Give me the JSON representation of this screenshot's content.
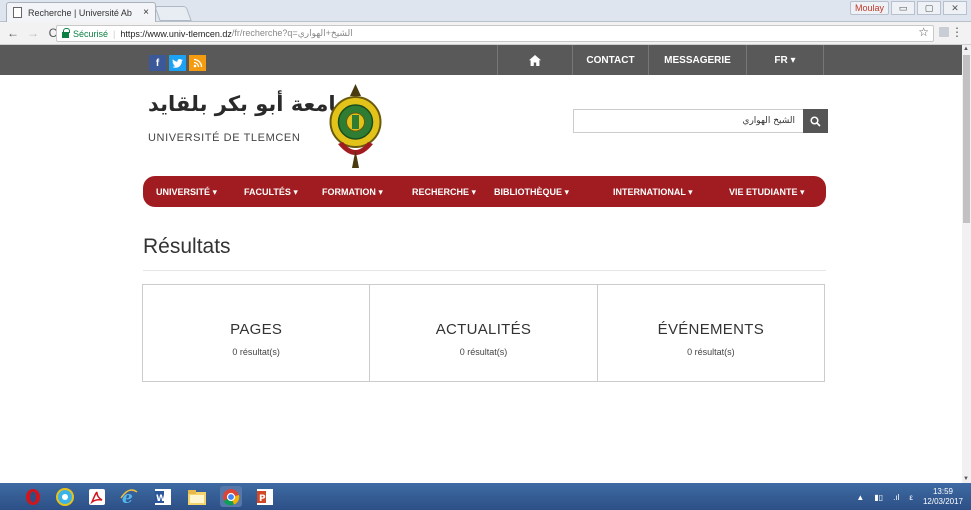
{
  "browser": {
    "tab_title": "Recherche | Université Ab",
    "tab_close": "×",
    "user_label": "Moulay",
    "win_minimize": "▭",
    "win_maximize": "▢",
    "win_close": "✕",
    "secure_label": "Sécurisé",
    "url_host": "https://www.univ-tlemcen.dz",
    "url_path": "/fr/recherche?q=الشيخ+الهواري",
    "back": "←",
    "forward": "→",
    "reload": "C",
    "bookmark_star": "☆",
    "menu": "⋮"
  },
  "topbar": {
    "social": [
      {
        "icon": "facebook-icon",
        "glyph": "f"
      },
      {
        "icon": "twitter-icon",
        "glyph": "t"
      },
      {
        "icon": "rss-icon",
        "glyph": "∷"
      }
    ],
    "home_icon": "home-icon",
    "contact": "CONTACT",
    "messagerie": "MESSAGERIE",
    "language": "FR ▾"
  },
  "header": {
    "logo_arabic": "جامعة أبو بكر بلقايد",
    "logo_french": "UNIVERSITÉ DE TLEMCEN",
    "search_value": "الشيخ الهواري"
  },
  "main_nav": [
    "UNIVERSITÉ ▾",
    "FACULTÉS ▾",
    "FORMATION ▾",
    "RECHERCHE ▾",
    "BIBLIOTHÈQUE ▾",
    "INTERNATIONAL ▾",
    "VIE ETUDIANTE ▾"
  ],
  "page": {
    "title": "Résultats",
    "results": [
      {
        "heading": "PAGES",
        "count": "0 résultat(s)"
      },
      {
        "heading": "ACTUALITÉS",
        "count": "0 résultat(s)"
      },
      {
        "heading": "ÉVÉNEMENTS",
        "count": "0 résultat(s)"
      }
    ]
  },
  "taskbar": {
    "apps": [
      "opera",
      "app2",
      "acrobat",
      "internet-explorer",
      "word",
      "explorer",
      "chrome",
      "powerpoint"
    ],
    "tray_lang": "ε",
    "time": "13:59",
    "date": "12/03/2017"
  },
  "colors": {
    "nav_red": "#a01c20",
    "topbar_gray": "#595959",
    "taskbar_blue": "#2c5086"
  }
}
